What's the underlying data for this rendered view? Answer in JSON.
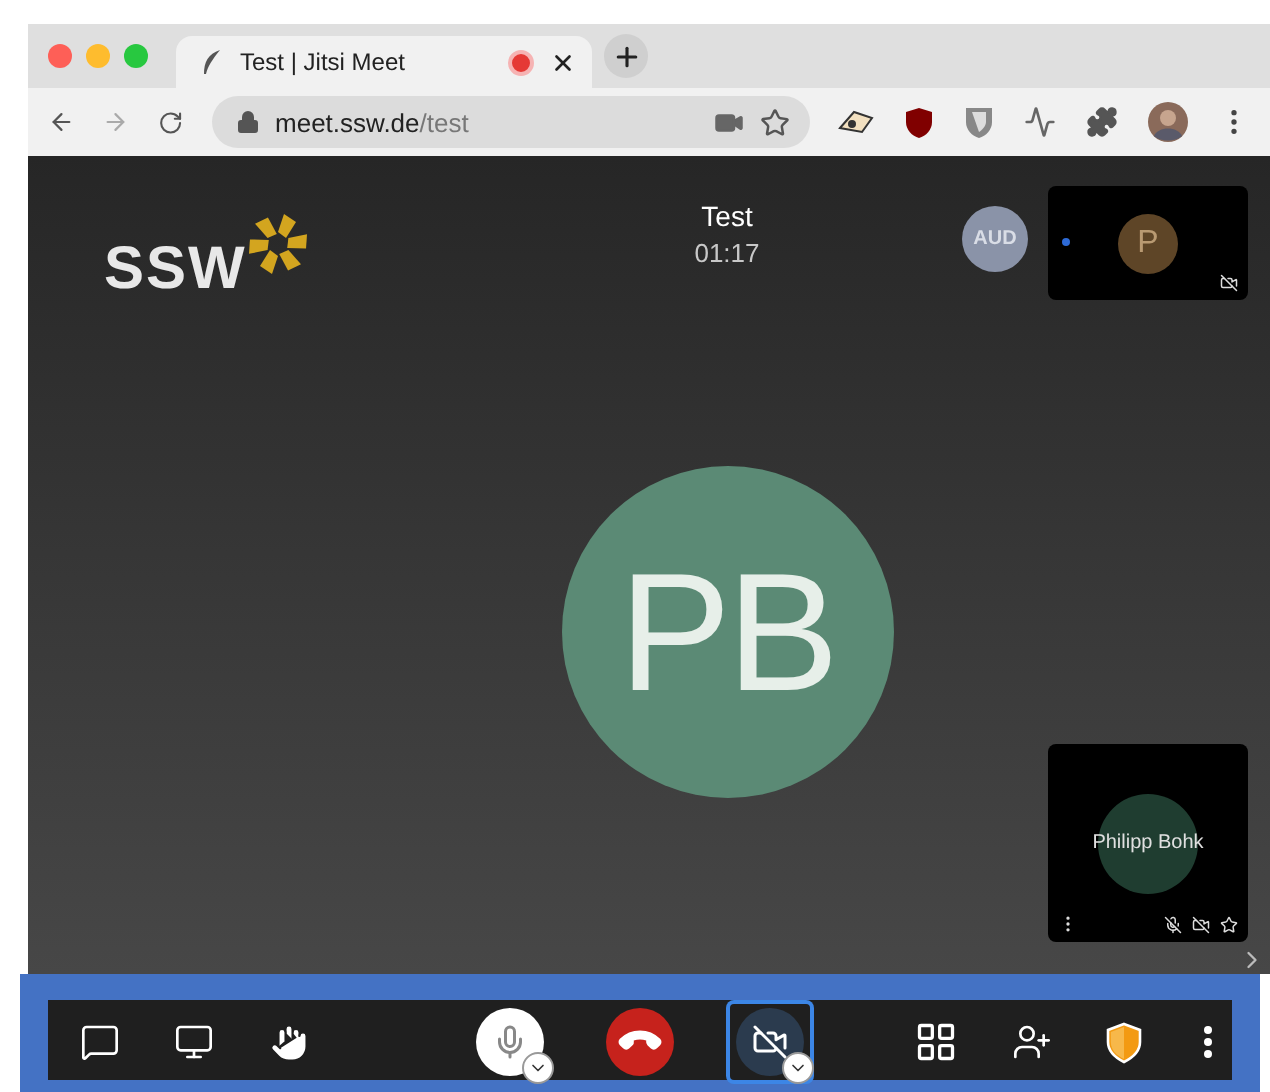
{
  "browser": {
    "tabs": [
      {
        "title": "Test | Jitsi Meet",
        "selected": true,
        "recording": true
      }
    ],
    "address": {
      "host": "meet.ssw.de",
      "path": "/test"
    }
  },
  "meeting": {
    "logo": "SSW",
    "title": "Test",
    "timer": "01:17",
    "speaker_initials": "PB"
  },
  "audio_badge": {
    "label": "AUD"
  },
  "thumbnails": [
    {
      "initials": "P",
      "color": "#5e4527",
      "mic_muted": false,
      "video_off": true,
      "indicator": true,
      "menu": false
    },
    {
      "name": "Philipp Bohk",
      "color": "#1f3d30",
      "mic_muted": true,
      "video_off": true,
      "indicator": false,
      "menu": true
    }
  ],
  "toolbar": [
    {
      "kind": "chat"
    },
    {
      "kind": "screenshare"
    },
    {
      "kind": "raisehand"
    },
    {
      "kind": "mic",
      "focused": false,
      "menu": true
    },
    {
      "kind": "hangup",
      "focused": false,
      "menu": false
    },
    {
      "kind": "camera",
      "focused": true,
      "menu": true
    },
    {
      "kind": "tileview"
    },
    {
      "kind": "invite"
    },
    {
      "kind": "security"
    },
    {
      "kind": "more"
    }
  ]
}
